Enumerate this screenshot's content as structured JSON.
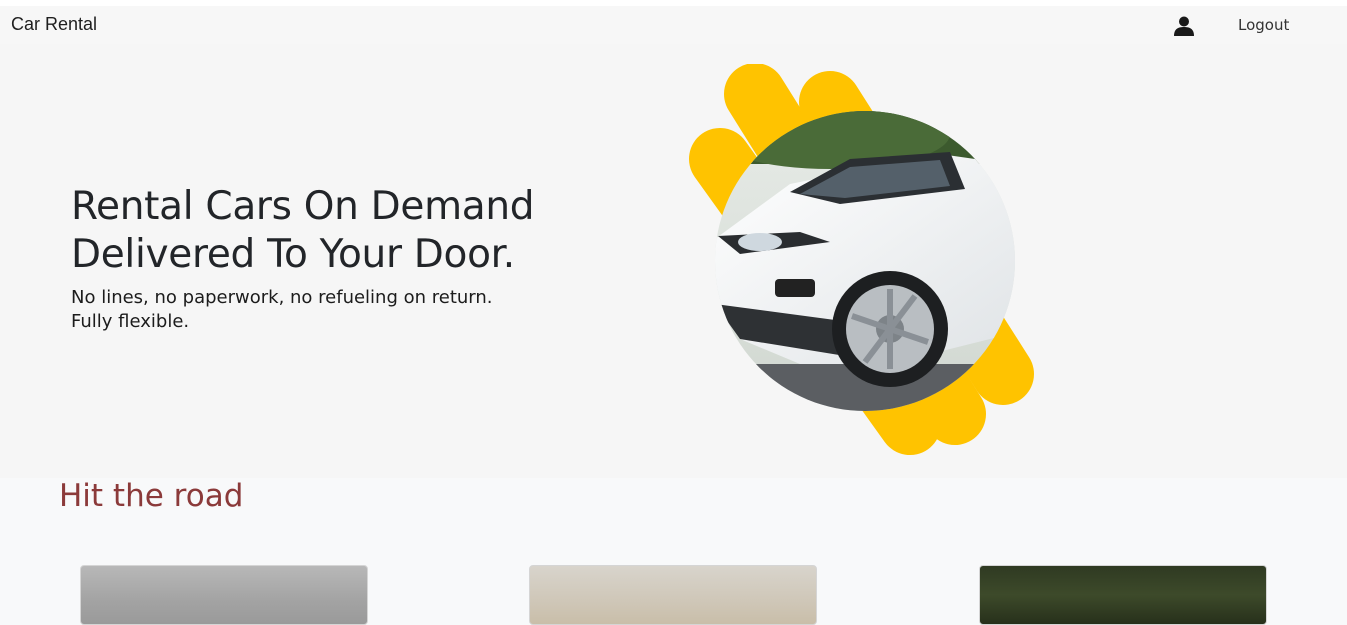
{
  "navbar": {
    "brand": "Car Rental",
    "logout_label": "Logout"
  },
  "hero": {
    "title_line1": "Rental Cars On Demand",
    "title_line2": "Delivered To Your Door.",
    "subtitle_line1": "No lines, no paperwork, no refueling on return.",
    "subtitle_line2": "Fully flexible."
  },
  "section": {
    "title": "Hit the road"
  },
  "colors": {
    "accent_yellow": "#FFC300",
    "section_title": "#8B3A3A"
  }
}
